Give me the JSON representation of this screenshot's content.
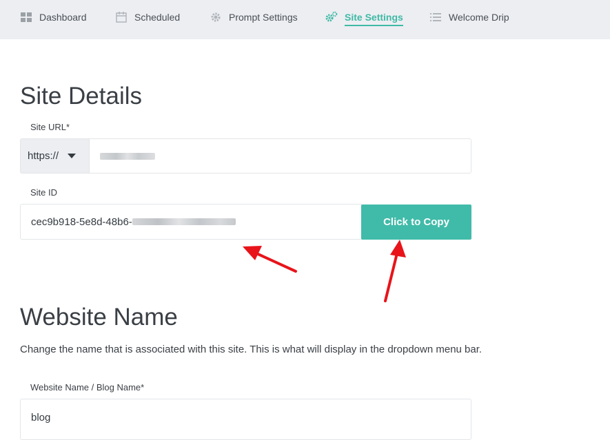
{
  "nav": {
    "items": [
      {
        "label": "Dashboard",
        "icon": "grid-icon"
      },
      {
        "label": "Scheduled",
        "icon": "calendar-icon"
      },
      {
        "label": "Prompt Settings",
        "icon": "gear-icon"
      },
      {
        "label": "Site Settings",
        "icon": "gears-icon",
        "active": true
      },
      {
        "label": "Welcome Drip",
        "icon": "list-icon"
      }
    ],
    "active_color": "#3fb9a5"
  },
  "site_details": {
    "heading": "Site Details",
    "url_label": "Site URL*",
    "protocol": "https://",
    "id_label": "Site ID",
    "site_id_prefix": "cec9b918-5e8d-48b6-",
    "copy_button": "Click to Copy"
  },
  "website_name": {
    "heading": "Website Name",
    "description": "Change the name that is associated with this site. This is what will display in the dropdown menu bar.",
    "field_label": "Website Name / Blog Name*",
    "value": "blog"
  },
  "colors": {
    "button": "#40bba9",
    "annotation_arrow": "#e8141a"
  }
}
